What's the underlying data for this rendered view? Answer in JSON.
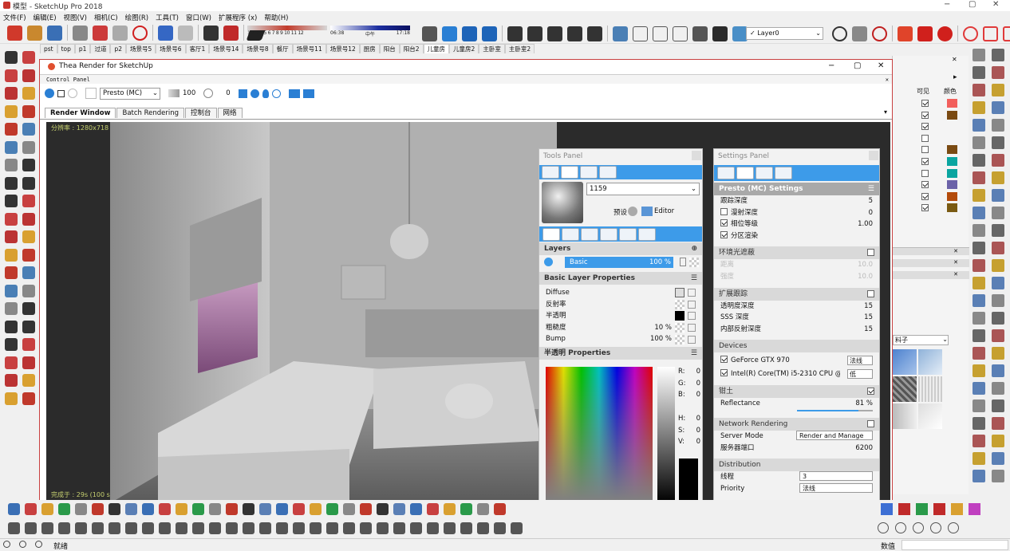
{
  "window": {
    "title": "模型 - SketchUp Pro 2018",
    "min": "−",
    "max": "▢",
    "close": "✕"
  },
  "menu": [
    "文件(F)",
    "编辑(E)",
    "视图(V)",
    "相机(C)",
    "绘图(R)",
    "工具(T)",
    "窗口(W)",
    "扩展程序 (x)",
    "帮助(H)"
  ],
  "timeline": {
    "months": "1 2 3 4 5 6 7 8 9 10 11 12",
    "time1": "06:38",
    "noon": "中午",
    "time2": "17:18"
  },
  "layer_select": "✓ Layer0",
  "scene_tabs": [
    "pst",
    "top",
    "p1",
    "过道",
    "p2",
    "场景号5",
    "场景号6",
    "客厅1",
    "场景号14",
    "场景号8",
    "餐厅",
    "场景号11",
    "场景号12",
    "厨房",
    "阳台",
    "阳台2",
    "儿童房",
    "儿童房2",
    "主卧室",
    "主卧室2"
  ],
  "scene_active": "儿童房",
  "thea": {
    "title": "Thea Render for SketchUp",
    "control_panel": "Control Panel",
    "preset": "Presto (MC)",
    "spp": "100",
    "time": "0",
    "tabs": [
      "Render Window",
      "Batch Rendering",
      "控制台",
      "网络"
    ],
    "resolution": "分辨率 : 1280x718",
    "finished": "完成于 : 29s (100 s/p)"
  },
  "tools_panel": {
    "title": "Tools Panel",
    "material_id": "1159",
    "preset_label": "预设",
    "editor_label": "Editor",
    "layers_header": "Layers",
    "layer_name": "Basic",
    "layer_pct": "100 %",
    "basic_props_header": "Basic Layer Properties",
    "props": [
      {
        "name": "Diffuse",
        "value": ""
      },
      {
        "name": "反射率",
        "value": ""
      },
      {
        "name": "半透明",
        "value": ""
      },
      {
        "name": "粗糙度",
        "value": "10 %"
      },
      {
        "name": "Bump",
        "value": "100 %"
      }
    ],
    "trans_header": "半透明 Properties",
    "rgb": [
      {
        "k": "R:",
        "v": "0"
      },
      {
        "k": "G:",
        "v": "0"
      },
      {
        "k": "B:",
        "v": "0"
      }
    ],
    "hsv": [
      {
        "k": "H:",
        "v": "0"
      },
      {
        "k": "S:",
        "v": "0"
      },
      {
        "k": "V:",
        "v": "0"
      }
    ]
  },
  "settings_panel": {
    "title": "Settings Panel",
    "header": "Presto (MC) Settings",
    "rows1": [
      {
        "label": "跟踪深度",
        "value": "5",
        "cb": null
      },
      {
        "label": "漫射深度",
        "value": "0",
        "cb": false
      },
      {
        "label": "相位等级",
        "value": "1.00",
        "cb": true
      },
      {
        "label": "分区渲染",
        "value": "",
        "cb": true
      }
    ],
    "ao_header": "环境光遮蔽",
    "ao_rows": [
      {
        "label": "距离",
        "value": "10.0"
      },
      {
        "label": "强度",
        "value": "10.0"
      }
    ],
    "ext_header": "扩展跟踪",
    "ext_rows": [
      {
        "label": "透明度深度",
        "value": "15"
      },
      {
        "label": "SSS 深度",
        "value": "15"
      },
      {
        "label": "内部反射深度",
        "value": "15"
      }
    ],
    "devices_header": "Devices",
    "devices": [
      {
        "label": "GeForce GTX 970",
        "mode": "法线"
      },
      {
        "label": "Intel(R) Core(TM) i5-2310 CPU @ 2....",
        "mode": "低"
      }
    ],
    "clamp_header": "钳土",
    "reflectance_label": "Reflectance",
    "reflectance_value": "81 %",
    "reflectance_frac": 0.81,
    "network_header": "Network Rendering",
    "server_mode_label": "Server Mode",
    "server_mode_value": "Render and Manage",
    "port_label": "服务器端口",
    "port_value": "6200",
    "dist_header": "Distribution",
    "threads_label": "线程",
    "threads_value": "3",
    "priority_label": "Priority",
    "priority_value": "法线"
  },
  "layers_tray": {
    "col_visible": "可见",
    "col_color": "颜色",
    "colors": [
      "#f25f5c",
      "#7a4a12",
      "",
      "",
      "#7a4a12",
      "#0aa5a0",
      "#0aa5a0",
      "#6b62a8",
      "#b34a0a",
      "#7a5a12"
    ],
    "checked": [
      true,
      true,
      true,
      false,
      false,
      true,
      false,
      true,
      true,
      true
    ]
  },
  "material_label": "料子",
  "status": {
    "text": "就绪",
    "measure": "数值"
  },
  "colors": {
    "accent": "#3d9be9",
    "titlebar": "#ffffff",
    "render_bg": "#2b2b2b"
  }
}
